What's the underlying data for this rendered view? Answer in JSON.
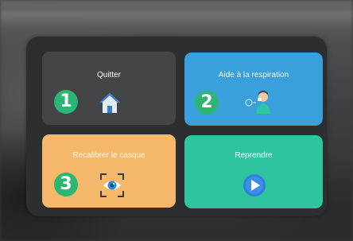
{
  "menu": {
    "tiles": [
      {
        "label": "Quitter",
        "number": "1",
        "icon": "home-icon"
      },
      {
        "label": "Aide à la respiration",
        "number": "2",
        "icon": "breathing-person-icon"
      },
      {
        "label": "Recalibrer le casque",
        "number": "3",
        "icon": "recalibrate-eye-icon"
      },
      {
        "label": "Reprendre",
        "icon": "play-icon"
      }
    ]
  },
  "colors": {
    "panel": "#2d2e2f",
    "quit_tile": "#444546",
    "breathing_tile": "#3aa0dc",
    "recalibrate_tile": "#f6b86b",
    "resume_tile": "#2ec49f",
    "number_badge": "#2bb673"
  }
}
